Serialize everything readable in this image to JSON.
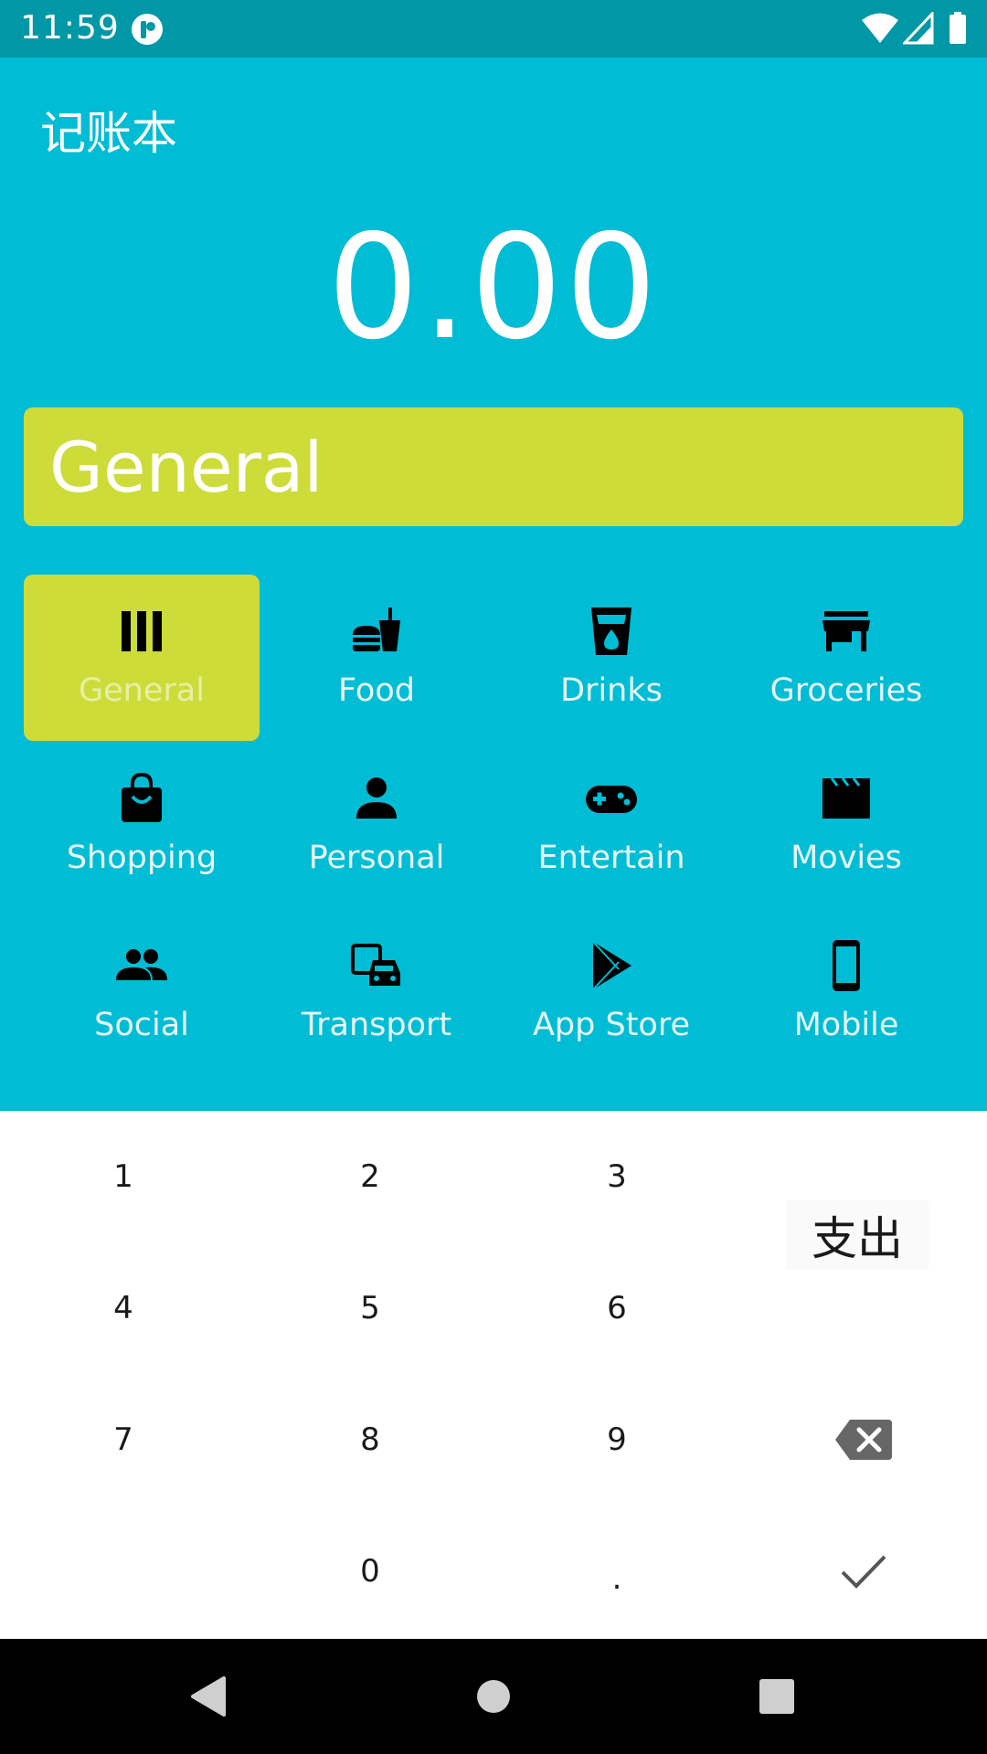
{
  "status_bar": {
    "time": "11:59",
    "icons": [
      "app-notification-icon",
      "wifi-icon",
      "cellular-signal-icon",
      "battery-icon"
    ]
  },
  "header": {
    "title": "记账本",
    "amount": "0.00",
    "selected_category": "General"
  },
  "categories": [
    {
      "label": "General",
      "icon": "bars-icon",
      "selected": true
    },
    {
      "label": "Food",
      "icon": "fastfood-icon",
      "selected": false
    },
    {
      "label": "Drinks",
      "icon": "drink-cup-icon",
      "selected": false
    },
    {
      "label": "Groceries",
      "icon": "store-icon",
      "selected": false
    },
    {
      "label": "Shopping",
      "icon": "shopping-bag-icon",
      "selected": false
    },
    {
      "label": "Personal",
      "icon": "person-icon",
      "selected": false
    },
    {
      "label": "Entertain",
      "icon": "gamepad-icon",
      "selected": false
    },
    {
      "label": "Movies",
      "icon": "movie-clapper-icon",
      "selected": false
    },
    {
      "label": "Social",
      "icon": "people-icon",
      "selected": false
    },
    {
      "label": "Transport",
      "icon": "transport-icon",
      "selected": false
    },
    {
      "label": "App Store",
      "icon": "play-store-icon",
      "selected": false
    },
    {
      "label": "Mobile",
      "icon": "smartphone-icon",
      "selected": false
    }
  ],
  "keypad": {
    "keys": {
      "k1": "1",
      "k2": "2",
      "k3": "3",
      "k4": "4",
      "k5": "5",
      "k6": "6",
      "k7": "7",
      "k8": "8",
      "k9": "9",
      "k0": "0",
      "dot": "."
    },
    "expense_label": "支出",
    "backspace_icon": "backspace-icon",
    "confirm_icon": "check-icon"
  },
  "nav_bar": {
    "icons": [
      "back-icon",
      "home-icon",
      "recents-icon"
    ]
  },
  "colors": {
    "primary": "#00bcd4",
    "status_bar": "#0097a7",
    "accent": "#cddc39"
  }
}
